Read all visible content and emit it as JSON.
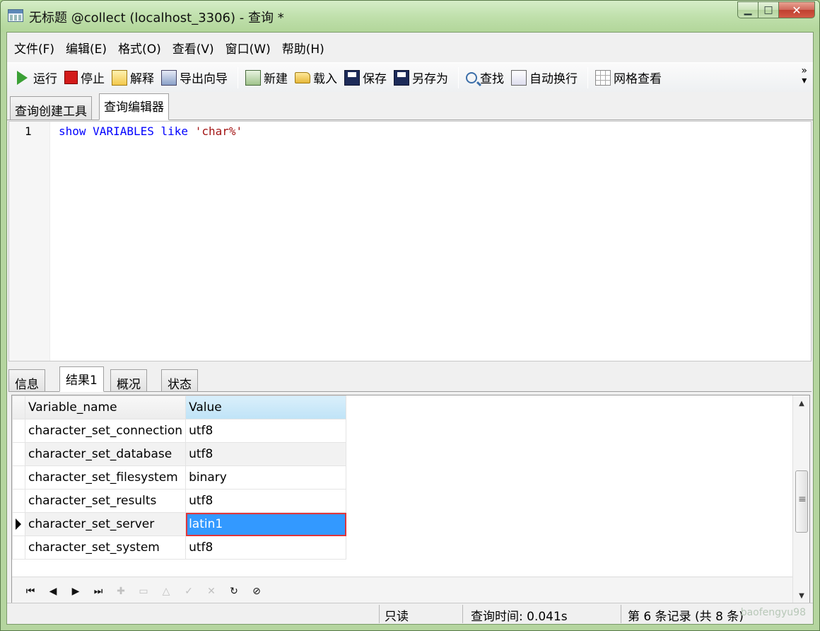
{
  "window": {
    "title": "无标题 @collect (localhost_3306) - 查询 *",
    "minimize_icon": "minimize-icon",
    "maximize_icon": "maximize-icon",
    "close_icon": "close-icon"
  },
  "menu": [
    "文件(F)",
    "编辑(E)",
    "格式(O)",
    "查看(V)",
    "窗口(W)",
    "帮助(H)"
  ],
  "toolbar": {
    "run": "运行",
    "stop": "停止",
    "explain": "解释",
    "export_wizard": "导出向导",
    "new": "新建",
    "load": "载入",
    "save": "保存",
    "save_as": "另存为",
    "find": "查找",
    "word_wrap": "自动换行",
    "grid_view": "网格查看",
    "more": "»"
  },
  "editor_tabs": [
    "查询创建工具",
    "查询编辑器"
  ],
  "editor": {
    "line_number": "1",
    "code_kw1": "show",
    "code_kw2": "VARIABLES",
    "code_kw3": "like",
    "code_str": "'char%'"
  },
  "result_tabs": [
    "信息",
    "结果1",
    "概况",
    "状态"
  ],
  "grid": {
    "headers": [
      "Variable_name",
      "Value"
    ],
    "rows": [
      {
        "name": "character_set_connection",
        "value": "utf8"
      },
      {
        "name": "character_set_database",
        "value": "utf8"
      },
      {
        "name": "character_set_filesystem",
        "value": "binary"
      },
      {
        "name": "character_set_results",
        "value": "utf8"
      },
      {
        "name": "character_set_server",
        "value": "latin1"
      },
      {
        "name": "character_set_system",
        "value": "utf8"
      }
    ],
    "selected_row": 4
  },
  "nav_icons": [
    "first-record-icon",
    "prev-record-icon",
    "next-record-icon",
    "last-record-icon",
    "add-record-icon",
    "delete-record-icon",
    "edit-record-icon",
    "apply-icon",
    "cancel-icon",
    "refresh-icon",
    "stop-icon"
  ],
  "status": {
    "readonly": "只读",
    "query_time": "查询时间: 0.041s",
    "records": "第 6 条记录 (共 8 条)",
    "watermark": "baofengyu98"
  },
  "colors": {
    "selection": "#3399ff",
    "highlight_border": "#e0353a",
    "keyword": "#0000ff",
    "string": "#a31515"
  }
}
